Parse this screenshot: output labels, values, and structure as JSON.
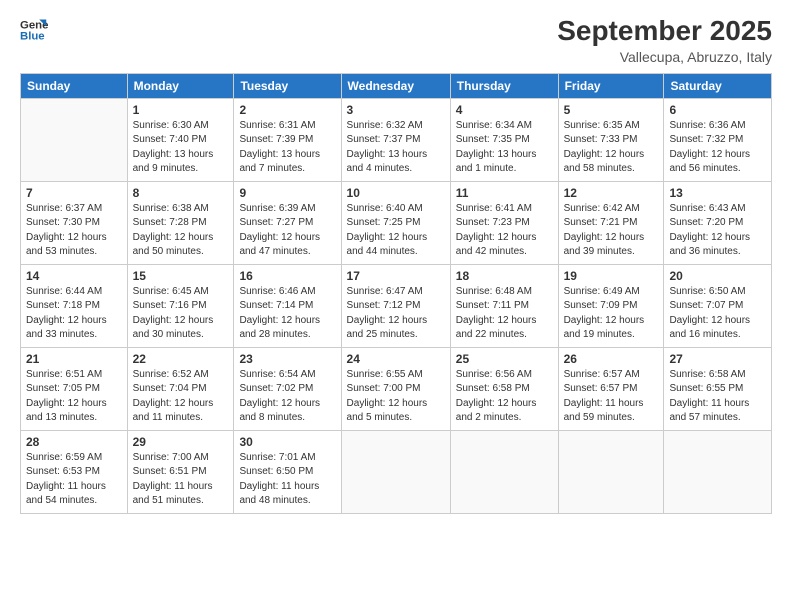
{
  "logo": {
    "line1": "General",
    "line2": "Blue"
  },
  "header": {
    "month": "September 2025",
    "location": "Vallecupa, Abruzzo, Italy"
  },
  "weekdays": [
    "Sunday",
    "Monday",
    "Tuesday",
    "Wednesday",
    "Thursday",
    "Friday",
    "Saturday"
  ],
  "weeks": [
    [
      {
        "day": "",
        "info": ""
      },
      {
        "day": "1",
        "info": "Sunrise: 6:30 AM\nSunset: 7:40 PM\nDaylight: 13 hours\nand 9 minutes."
      },
      {
        "day": "2",
        "info": "Sunrise: 6:31 AM\nSunset: 7:39 PM\nDaylight: 13 hours\nand 7 minutes."
      },
      {
        "day": "3",
        "info": "Sunrise: 6:32 AM\nSunset: 7:37 PM\nDaylight: 13 hours\nand 4 minutes."
      },
      {
        "day": "4",
        "info": "Sunrise: 6:34 AM\nSunset: 7:35 PM\nDaylight: 13 hours\nand 1 minute."
      },
      {
        "day": "5",
        "info": "Sunrise: 6:35 AM\nSunset: 7:33 PM\nDaylight: 12 hours\nand 58 minutes."
      },
      {
        "day": "6",
        "info": "Sunrise: 6:36 AM\nSunset: 7:32 PM\nDaylight: 12 hours\nand 56 minutes."
      }
    ],
    [
      {
        "day": "7",
        "info": "Sunrise: 6:37 AM\nSunset: 7:30 PM\nDaylight: 12 hours\nand 53 minutes."
      },
      {
        "day": "8",
        "info": "Sunrise: 6:38 AM\nSunset: 7:28 PM\nDaylight: 12 hours\nand 50 minutes."
      },
      {
        "day": "9",
        "info": "Sunrise: 6:39 AM\nSunset: 7:27 PM\nDaylight: 12 hours\nand 47 minutes."
      },
      {
        "day": "10",
        "info": "Sunrise: 6:40 AM\nSunset: 7:25 PM\nDaylight: 12 hours\nand 44 minutes."
      },
      {
        "day": "11",
        "info": "Sunrise: 6:41 AM\nSunset: 7:23 PM\nDaylight: 12 hours\nand 42 minutes."
      },
      {
        "day": "12",
        "info": "Sunrise: 6:42 AM\nSunset: 7:21 PM\nDaylight: 12 hours\nand 39 minutes."
      },
      {
        "day": "13",
        "info": "Sunrise: 6:43 AM\nSunset: 7:20 PM\nDaylight: 12 hours\nand 36 minutes."
      }
    ],
    [
      {
        "day": "14",
        "info": "Sunrise: 6:44 AM\nSunset: 7:18 PM\nDaylight: 12 hours\nand 33 minutes."
      },
      {
        "day": "15",
        "info": "Sunrise: 6:45 AM\nSunset: 7:16 PM\nDaylight: 12 hours\nand 30 minutes."
      },
      {
        "day": "16",
        "info": "Sunrise: 6:46 AM\nSunset: 7:14 PM\nDaylight: 12 hours\nand 28 minutes."
      },
      {
        "day": "17",
        "info": "Sunrise: 6:47 AM\nSunset: 7:12 PM\nDaylight: 12 hours\nand 25 minutes."
      },
      {
        "day": "18",
        "info": "Sunrise: 6:48 AM\nSunset: 7:11 PM\nDaylight: 12 hours\nand 22 minutes."
      },
      {
        "day": "19",
        "info": "Sunrise: 6:49 AM\nSunset: 7:09 PM\nDaylight: 12 hours\nand 19 minutes."
      },
      {
        "day": "20",
        "info": "Sunrise: 6:50 AM\nSunset: 7:07 PM\nDaylight: 12 hours\nand 16 minutes."
      }
    ],
    [
      {
        "day": "21",
        "info": "Sunrise: 6:51 AM\nSunset: 7:05 PM\nDaylight: 12 hours\nand 13 minutes."
      },
      {
        "day": "22",
        "info": "Sunrise: 6:52 AM\nSunset: 7:04 PM\nDaylight: 12 hours\nand 11 minutes."
      },
      {
        "day": "23",
        "info": "Sunrise: 6:54 AM\nSunset: 7:02 PM\nDaylight: 12 hours\nand 8 minutes."
      },
      {
        "day": "24",
        "info": "Sunrise: 6:55 AM\nSunset: 7:00 PM\nDaylight: 12 hours\nand 5 minutes."
      },
      {
        "day": "25",
        "info": "Sunrise: 6:56 AM\nSunset: 6:58 PM\nDaylight: 12 hours\nand 2 minutes."
      },
      {
        "day": "26",
        "info": "Sunrise: 6:57 AM\nSunset: 6:57 PM\nDaylight: 11 hours\nand 59 minutes."
      },
      {
        "day": "27",
        "info": "Sunrise: 6:58 AM\nSunset: 6:55 PM\nDaylight: 11 hours\nand 57 minutes."
      }
    ],
    [
      {
        "day": "28",
        "info": "Sunrise: 6:59 AM\nSunset: 6:53 PM\nDaylight: 11 hours\nand 54 minutes."
      },
      {
        "day": "29",
        "info": "Sunrise: 7:00 AM\nSunset: 6:51 PM\nDaylight: 11 hours\nand 51 minutes."
      },
      {
        "day": "30",
        "info": "Sunrise: 7:01 AM\nSunset: 6:50 PM\nDaylight: 11 hours\nand 48 minutes."
      },
      {
        "day": "",
        "info": ""
      },
      {
        "day": "",
        "info": ""
      },
      {
        "day": "",
        "info": ""
      },
      {
        "day": "",
        "info": ""
      }
    ]
  ]
}
